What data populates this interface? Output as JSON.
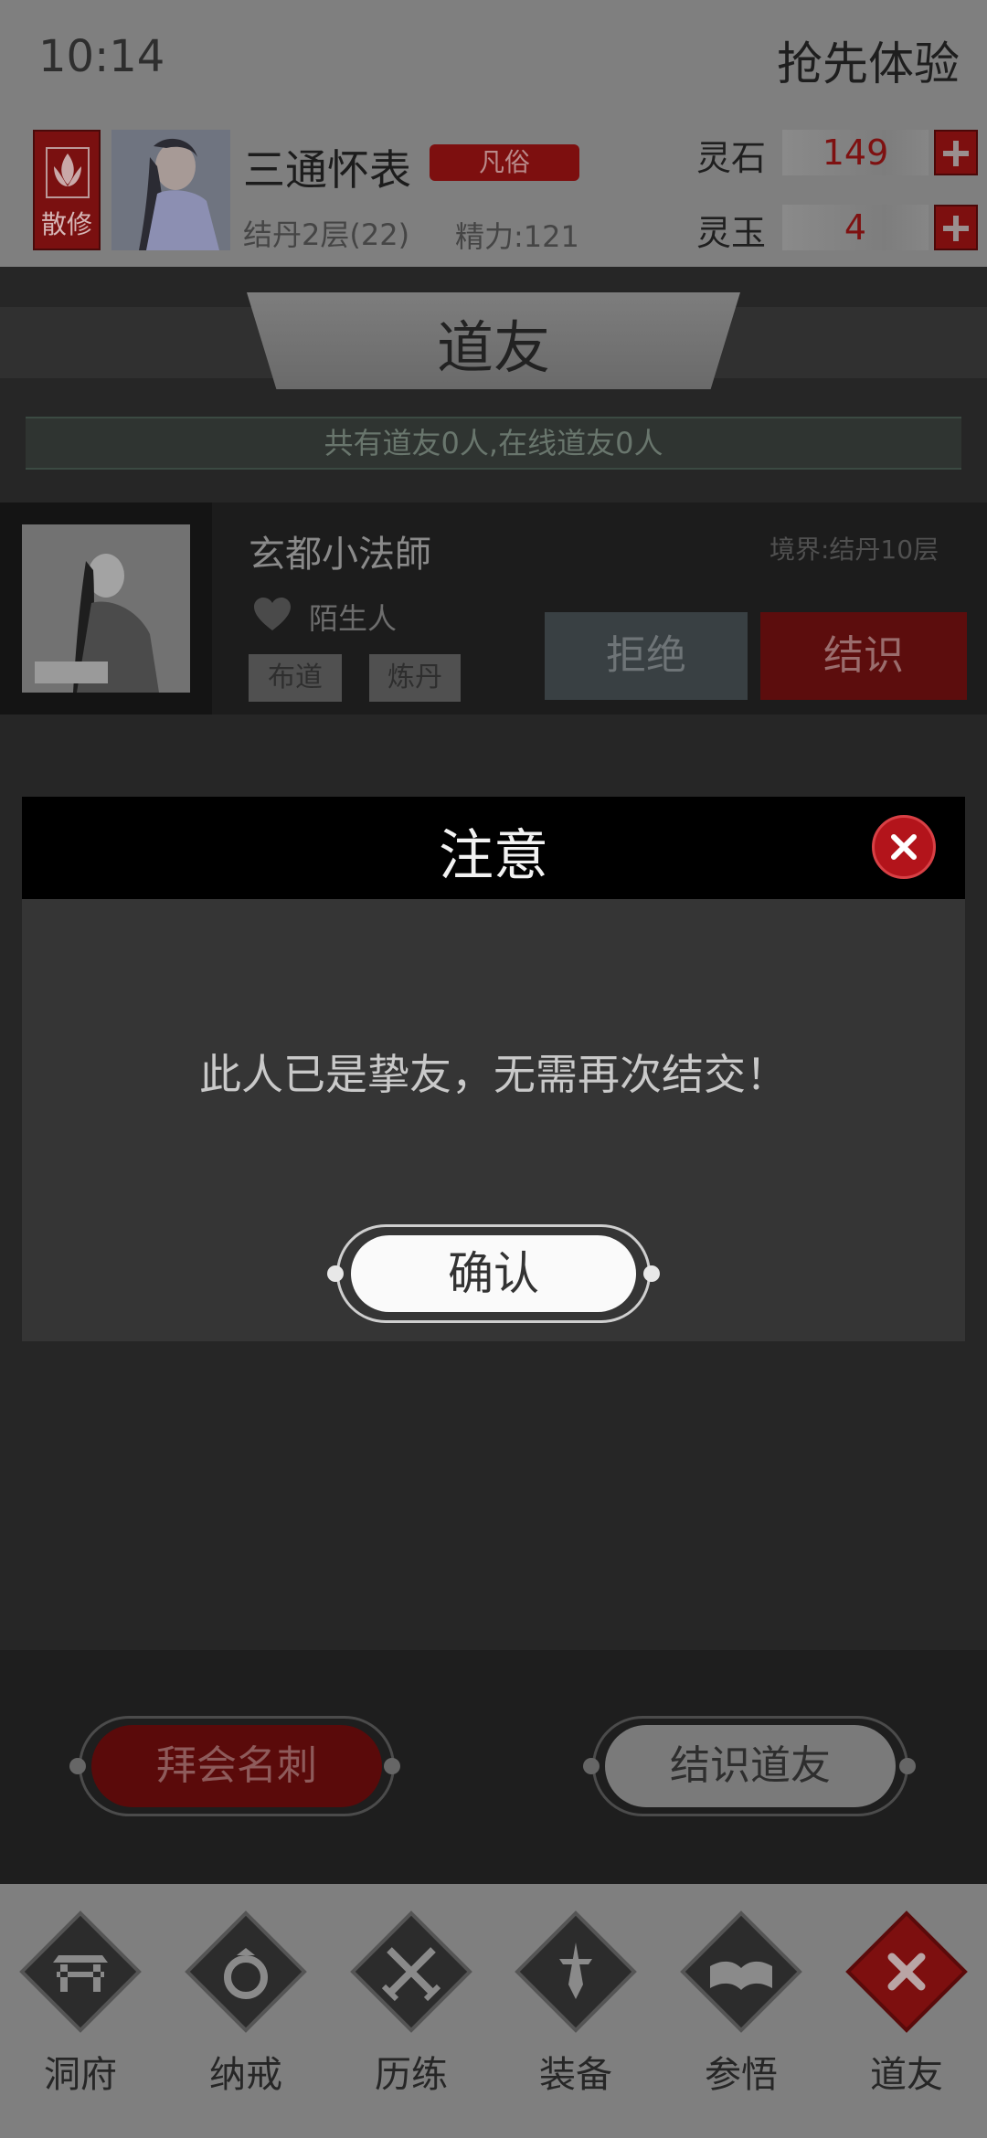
{
  "status_bar": {
    "time": "10:14",
    "trial_label": "抢先体验"
  },
  "player": {
    "sect_badge": "散修",
    "name": "三通怀表",
    "rank_tag": "凡俗",
    "realm": "结丹2层(22)",
    "energy": "精力:121"
  },
  "currencies": [
    {
      "label": "灵石",
      "value": "149"
    },
    {
      "label": "灵玉",
      "value": "4"
    }
  ],
  "page_title": "道友",
  "friend_count_text": "共有道友0人,在线道友0人",
  "friend_card": {
    "name": "玄都小法師",
    "realm": "境界:结丹10层",
    "relation": "陌生人",
    "tags": [
      "布道",
      "炼丹"
    ],
    "refuse_label": "拒绝",
    "befriend_label": "结识"
  },
  "dialog": {
    "title": "注意",
    "message": "此人已是挚友，无需再次结交！",
    "confirm_label": "确认"
  },
  "actions": {
    "visit_card_label": "拜会名刺",
    "make_friend_label": "结识道友"
  },
  "nav": [
    {
      "label": "洞府",
      "icon": "cave-gate-icon"
    },
    {
      "label": "纳戒",
      "icon": "ring-icon"
    },
    {
      "label": "历练",
      "icon": "crossed-swords-icon"
    },
    {
      "label": "装备",
      "icon": "dagger-icon"
    },
    {
      "label": "参悟",
      "icon": "open-book-icon"
    },
    {
      "label": "道友",
      "icon": "friends-x-icon",
      "active": true
    }
  ],
  "colors": {
    "accent_red": "#7d0f0f",
    "close_red": "#b3141b",
    "overlay_gray": "#7f7f7f"
  }
}
